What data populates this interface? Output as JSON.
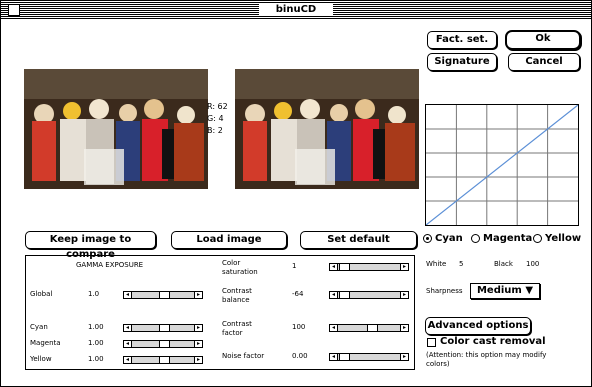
{
  "window": {
    "title": "binuCD"
  },
  "buttons": {
    "fact_set": "Fact. set.",
    "ok": "Ok",
    "signature": "Signature",
    "cancel": "Cancel",
    "keep_image": "Keep image to compare",
    "load_image": "Load image",
    "set_default": "Set default",
    "advanced_options": "Advanced options"
  },
  "readout": {
    "r": "R: 62",
    "g": "G: 4",
    "b": "B: 2"
  },
  "channels": {
    "items": [
      "Cyan",
      "Magenta",
      "Yellow"
    ],
    "selected": "Cyan"
  },
  "panel": {
    "gamma_exposure_label": "GAMMA EXPOSURE",
    "rows": [
      {
        "label": "Global",
        "value": "1.0",
        "level": 0.5
      },
      {
        "label": "Cyan",
        "value": "1.00",
        "level": 0.5
      },
      {
        "label": "Magenta",
        "value": "1.00",
        "level": 0.5
      },
      {
        "label": "Yellow",
        "value": "1.00",
        "level": 0.5
      }
    ],
    "right_rows": [
      {
        "label_line1": "Color",
        "label_line2": "saturation",
        "value": "1",
        "level": 0.03
      },
      {
        "label_line1": "Contrast",
        "label_line2": "balance",
        "value": "-64",
        "level": 0.03
      },
      {
        "label_line1": "Contrast",
        "label_line2": "factor",
        "value": "100",
        "level": 0.55
      },
      {
        "label_line1": "Noise factor",
        "label_line2": "",
        "value": "0.00",
        "level": 0.03
      }
    ]
  },
  "levels": {
    "white_label": "White",
    "white_value": "5",
    "black_label": "Black",
    "black_value": "100"
  },
  "sharpness": {
    "label": "Sharpness",
    "value": "Medium"
  },
  "color_cast": {
    "label": "Color cast removal",
    "checked": false,
    "note_line1": "(Attention: this option may modify",
    "note_line2": "colors)"
  }
}
